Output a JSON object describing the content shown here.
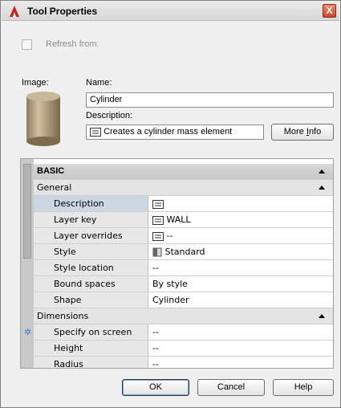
{
  "window": {
    "title": "Tool Properties",
    "close_glyph": "X"
  },
  "refresh": {
    "label": "Refresh from:"
  },
  "image": {
    "label": "Image:"
  },
  "name_field": {
    "label": "Name:",
    "value": "Cylinder"
  },
  "description_field": {
    "label": "Description:",
    "value": "Creates a cylinder mass element"
  },
  "more_info": {
    "label_prefix": "More ",
    "label_underline": "I",
    "label_suffix": "nfo"
  },
  "grid": {
    "category": "BASIC",
    "sections": [
      {
        "name": "General",
        "rows": [
          {
            "name": "Description",
            "value": "",
            "icon": "doc-icon",
            "selected": true
          },
          {
            "name": "Layer key",
            "value": "WALL",
            "icon": "doc-icon"
          },
          {
            "name": "Layer overrides",
            "value": "--",
            "icon": "doc-icon"
          },
          {
            "name": "Style",
            "value": "Standard",
            "icon": "style-icon"
          },
          {
            "name": "Style location",
            "value": "--"
          },
          {
            "name": "Bound spaces",
            "value": "By style"
          },
          {
            "name": "Shape",
            "value": "Cylinder"
          }
        ]
      },
      {
        "name": "Dimensions",
        "rows": [
          {
            "name": "Specify on screen",
            "value": "--",
            "marker": "✲"
          },
          {
            "name": "Height",
            "value": "--"
          },
          {
            "name": "Radius",
            "value": "--"
          }
        ]
      }
    ]
  },
  "buttons": {
    "ok": "OK",
    "cancel": "Cancel",
    "help": "Help"
  },
  "colors": {
    "close_button": "#c94a2a",
    "title_bar": "#e0e0e0",
    "selected_row": "#cdd7e3"
  }
}
